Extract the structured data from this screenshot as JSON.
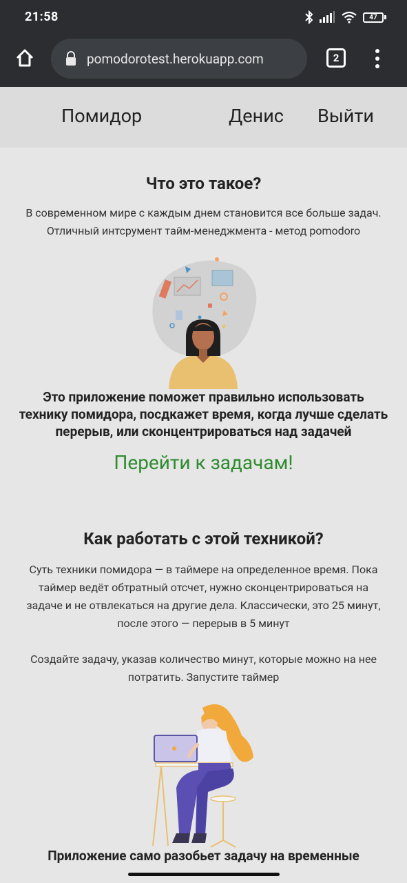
{
  "status_bar": {
    "time": "21:58",
    "battery": "47"
  },
  "browser": {
    "url": "pomodorotest.herokuapp.com",
    "tab_count": "2"
  },
  "nav": {
    "brand": "Помидор",
    "user": "Денис",
    "logout": "Выйти"
  },
  "section1": {
    "title": "Что это такое?",
    "text_line1": "В современном мире с каждым днем становится все больше задач.",
    "text_line2": "Отличный интсрумент тайм-менеджмента - метод pomodoro",
    "bold_line1": "Это приложение поможет правильно использовать",
    "bold_line2": "технику помидора, посдкажет время, когда лучше сделать",
    "bold_line3": "перерыв, или сконцентрироваться над задачей",
    "cta": "Перейти к задачам!"
  },
  "section2": {
    "title": "Как работать с этой техникой?",
    "p1_line1": "Суть техники помидора — в таймере на определенное время. Пока",
    "p1_line2": "таймер ведёт обтратный отсчет, нужно сконцентрироваться на",
    "p1_line3": "задаче и не отвлекаться на другие дела. Классически, это 25 минут,",
    "p1_line4": "после этого — перерыв в 5 минут",
    "p2_line1": "Создайте задачу, указав количество минут, которые можно на нее",
    "p2_line2": "потратить. Запустите таймер",
    "partial_bold": "Приложение само разобьет задачу на временные"
  }
}
